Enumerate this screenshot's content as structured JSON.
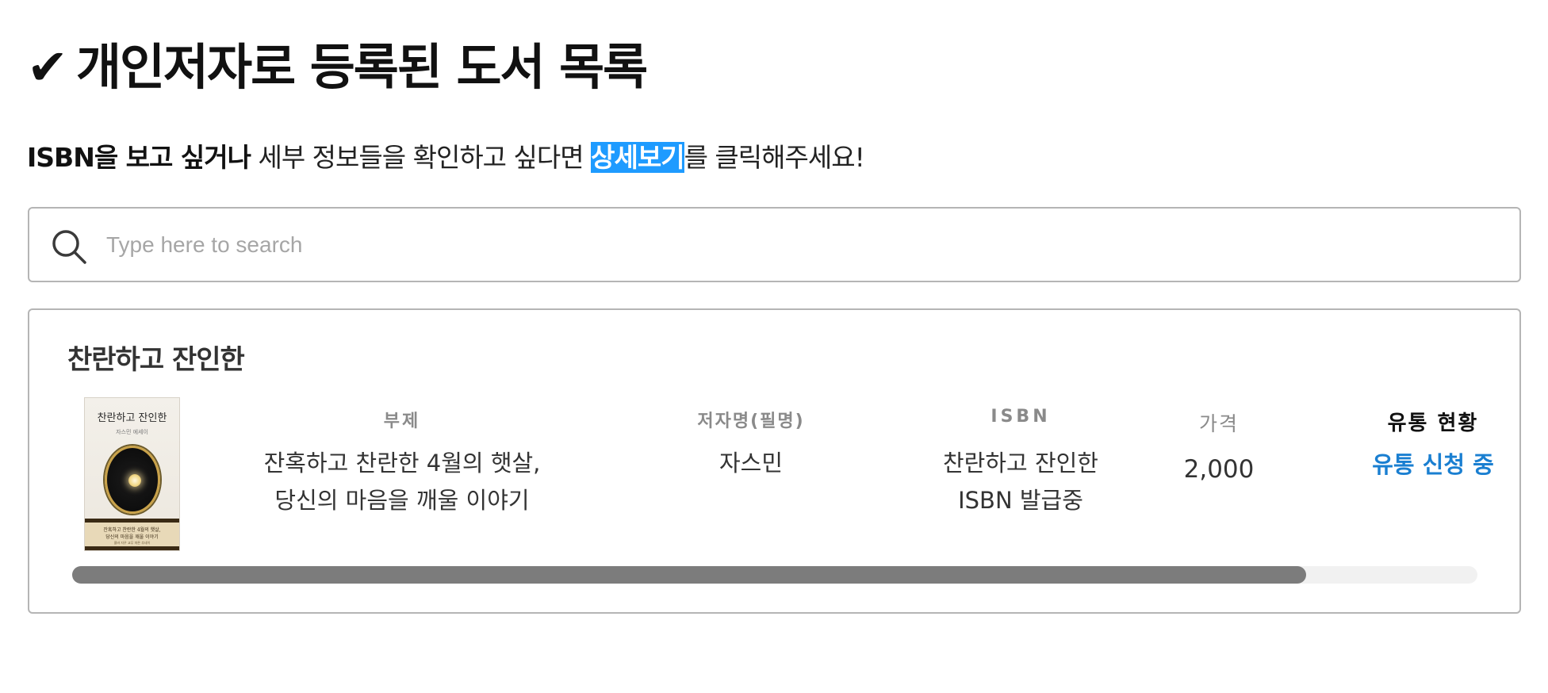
{
  "page": {
    "check_mark": "✔",
    "title": "개인저자로 등록된 도서 목록"
  },
  "subtitle": {
    "strong": "ISBN을 보고 싶거나",
    "text1": " 세부 정보들을 확인하고 싶다면 ",
    "highlight": "상세보기",
    "text2": "를 클릭해주세요!"
  },
  "search": {
    "placeholder": "Type here to search",
    "value": ""
  },
  "book": {
    "title": "찬란하고 잔인한",
    "cover": {
      "title": "찬란하고 잔인한",
      "subtitle": "자스민 에세이",
      "band_line1": "잔혹하고 찬란한 4월의 햇살,",
      "band_line2": "당신의 마음을 깨울 이야기",
      "band_line3": "올바 자꾸 교무 마른 추네이"
    },
    "columns": {
      "subtitle_header": "부제",
      "author_header": "저자명(필명)",
      "isbn_header": "ISBN",
      "price_header": "가격",
      "status_header": "유통 현황"
    },
    "values": {
      "subtitle_line1": "잔혹하고 찬란한 4월의 햇살,",
      "subtitle_line2": "당신의 마음을 깨울 이야기",
      "author": "자스민",
      "isbn_line1": "찬란하고 잔인한",
      "isbn_line2": "ISBN 발급중",
      "price": "2,000",
      "status": "유통 신청 중"
    },
    "scroll": {
      "position_fraction": 0.0,
      "visible_fraction": 0.878
    }
  },
  "colors": {
    "accent_link": "#1a7fd1",
    "highlight": "#1e9bff",
    "scroll_thumb": "#7c7c7c",
    "border": "#b5b5b5"
  }
}
